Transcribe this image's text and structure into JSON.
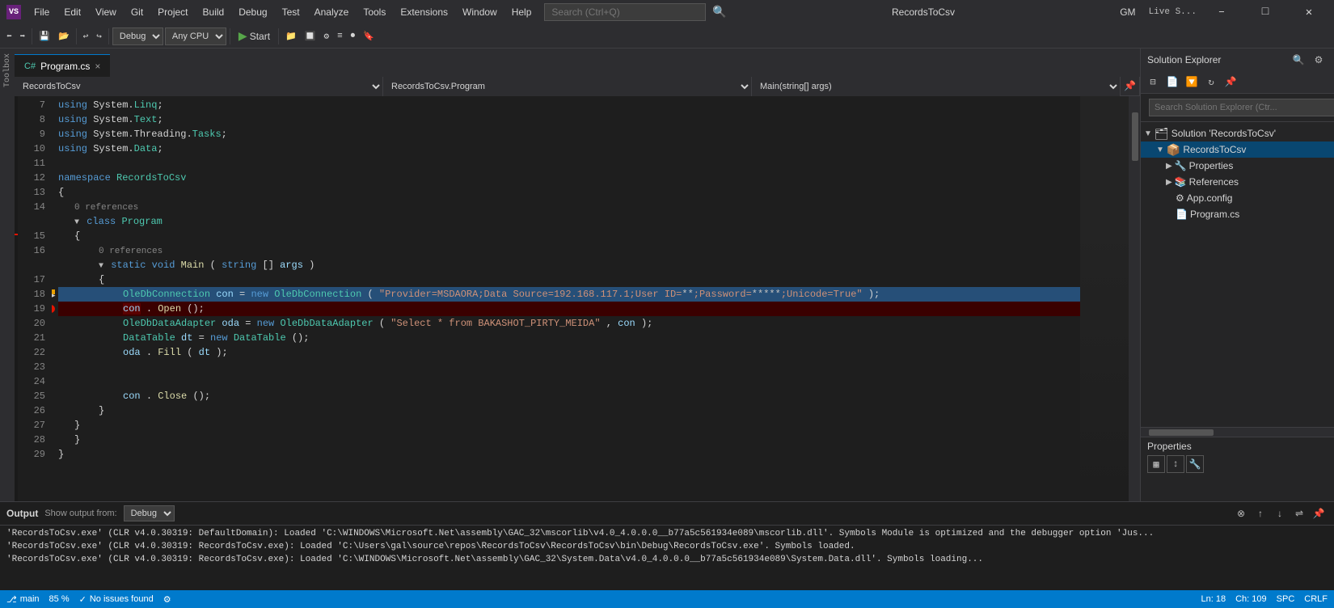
{
  "title_bar": {
    "logo": "VS",
    "menu_items": [
      "File",
      "Edit",
      "View",
      "Git",
      "Project",
      "Build",
      "Debug",
      "Test",
      "Analyze",
      "Tools",
      "Extensions",
      "Window",
      "Help"
    ],
    "search_placeholder": "Search (Ctrl+Q)",
    "window_title": "RecordsToCsv",
    "user_initials": "GM",
    "minimize": "–",
    "maximize": "□",
    "close": "✕"
  },
  "toolbar": {
    "config_dropdown": "Debug",
    "platform_dropdown": "Any CPU",
    "start_label": "Start",
    "live_share": "Live S..."
  },
  "tabs": [
    {
      "label": "Program.cs",
      "active": true,
      "close": "×"
    }
  ],
  "nav": {
    "left": "RecordsToCsv",
    "middle": "RecordsToCsv.Program",
    "right": "Main(string[] args)"
  },
  "code_lines": [
    {
      "num": 7,
      "content": "using System.Linq;",
      "type": "using"
    },
    {
      "num": 8,
      "content": "using System.Text;",
      "type": "using"
    },
    {
      "num": 9,
      "content": "using System.Threading.Tasks;",
      "type": "using"
    },
    {
      "num": 10,
      "content": "using System.Data;",
      "type": "using"
    },
    {
      "num": 11,
      "content": "",
      "type": "blank"
    },
    {
      "num": 12,
      "content": "namespace RecordsToCsv",
      "type": "namespace"
    },
    {
      "num": 13,
      "content": "{",
      "type": "plain"
    },
    {
      "num": 14,
      "content": "    0 references\n    class Program",
      "type": "class",
      "ref": "0 references"
    },
    {
      "num": 15,
      "content": "    {",
      "type": "plain"
    },
    {
      "num": 16,
      "content": "        0 references\n        static void Main(string[] args)",
      "type": "method",
      "ref": "0 references"
    },
    {
      "num": 17,
      "content": "        {",
      "type": "plain"
    },
    {
      "num": 18,
      "content": "            OleDbConnection con = new OleDbConnection(\"Provider=MSDAORA;Data Source=192.168.117.1;User ID=**;Password=*****;Unicode=True\");",
      "type": "code",
      "highlighted": true
    },
    {
      "num": 19,
      "content": "            con.Open();",
      "type": "code",
      "breakpoint": true
    },
    {
      "num": 20,
      "content": "            OleDbDataAdapter oda = new OleDbDataAdapter(\"Select * from BAKASHOT_PIRTY_MEIDA\", con);",
      "type": "code"
    },
    {
      "num": 21,
      "content": "            DataTable dt = new DataTable();",
      "type": "code"
    },
    {
      "num": 22,
      "content": "            oda.Fill(dt);",
      "type": "code"
    },
    {
      "num": 23,
      "content": "",
      "type": "blank"
    },
    {
      "num": 24,
      "content": "",
      "type": "blank"
    },
    {
      "num": 25,
      "content": "            con.Close();",
      "type": "code"
    },
    {
      "num": 26,
      "content": "        }",
      "type": "plain"
    },
    {
      "num": 27,
      "content": "    }",
      "type": "plain"
    },
    {
      "num": 28,
      "content": "    }",
      "type": "plain"
    },
    {
      "num": 29,
      "content": "}",
      "type": "plain"
    }
  ],
  "solution_explorer": {
    "title": "Solution Explorer",
    "search_placeholder": "Search Solution Explorer (Ctr...",
    "solution_label": "Solution 'RecordsToCsv'",
    "project_label": "RecordsToCsv",
    "items": [
      {
        "label": "Properties",
        "icon": "📄",
        "indent": 1
      },
      {
        "label": "References",
        "icon": "📚",
        "indent": 1
      },
      {
        "label": "App.config",
        "icon": "⚙",
        "indent": 1
      },
      {
        "label": "Program.cs",
        "icon": "📄",
        "indent": 1
      }
    ]
  },
  "properties": {
    "title": "Properties"
  },
  "status_bar": {
    "zoom": "85 %",
    "status": "No issues found",
    "status_icon": "✓",
    "position": "Ln: 18",
    "col": "Ch: 109",
    "indent": "SPC",
    "line_ending": "CRLF"
  },
  "output": {
    "title": "Output",
    "source_label": "Show output from:",
    "source": "Debug",
    "lines": [
      "'RecordsToCsv.exe' (CLR v4.0.30319: DefaultDomain): Loaded 'C:\\WINDOWS\\Microsoft.Net\\assembly\\GAC_32\\mscorlib\\v4.0_4.0.0.0__b77a5c561934e089\\mscorlib.dll'. Symbols  Module is optimized and the debugger option 'Jus...",
      "'RecordsToCsv.exe' (CLR v4.0.30319: RecordsToCsv.exe): Loaded 'C:\\Users\\gal\\source\\repos\\RecordsToCsv\\RecordsToCsv\\bin\\Debug\\RecordsToCsv.exe'. Symbols loaded.",
      "'RecordsToCsv.exe' (CLR v4.0.30319: RecordsToCsv.exe): Loaded 'C:\\WINDOWS\\Microsoft.Net\\assembly\\GAC_32\\System.Data\\v4.0_4.0.0.0__b77a5c561934e089\\System.Data.dll'. Symbols loading..."
    ]
  }
}
